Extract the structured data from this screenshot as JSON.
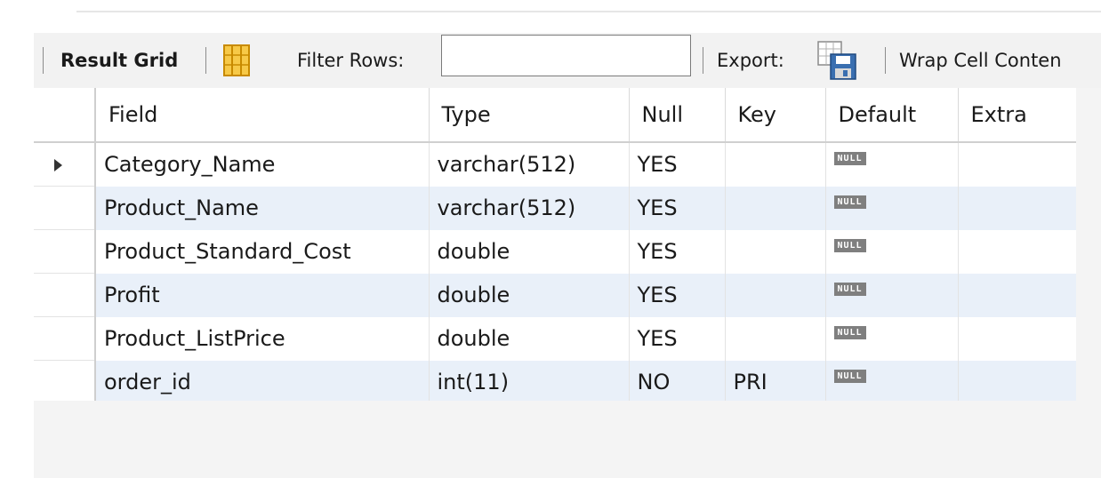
{
  "toolbar": {
    "result_grid_label": "Result Grid",
    "filter_rows_label": "Filter Rows:",
    "filter_value": "",
    "export_label": "Export:",
    "wrap_label": "Wrap Cell Conten"
  },
  "grid": {
    "columns": [
      "Field",
      "Type",
      "Null",
      "Key",
      "Default",
      "Extra"
    ],
    "rows": [
      {
        "field": "Category_Name",
        "type": "varchar(512)",
        "null": "YES",
        "key": "",
        "default": "NULL",
        "extra": ""
      },
      {
        "field": "Product_Name",
        "type": "varchar(512)",
        "null": "YES",
        "key": "",
        "default": "NULL",
        "extra": ""
      },
      {
        "field": "Product_Standard_Cost",
        "type": "double",
        "null": "YES",
        "key": "",
        "default": "NULL",
        "extra": ""
      },
      {
        "field": "Profit",
        "type": "double",
        "null": "YES",
        "key": "",
        "default": "NULL",
        "extra": ""
      },
      {
        "field": "Product_ListPrice",
        "type": "double",
        "null": "YES",
        "key": "",
        "default": "NULL",
        "extra": ""
      },
      {
        "field": "order_id",
        "type": "int(11)",
        "null": "NO",
        "key": "PRI",
        "default": "NULL",
        "extra": ""
      }
    ]
  },
  "icons": {
    "grid_toggle": "column-layout-icon",
    "export": "export-save-icon",
    "current_row": "current-row-arrow-icon"
  }
}
